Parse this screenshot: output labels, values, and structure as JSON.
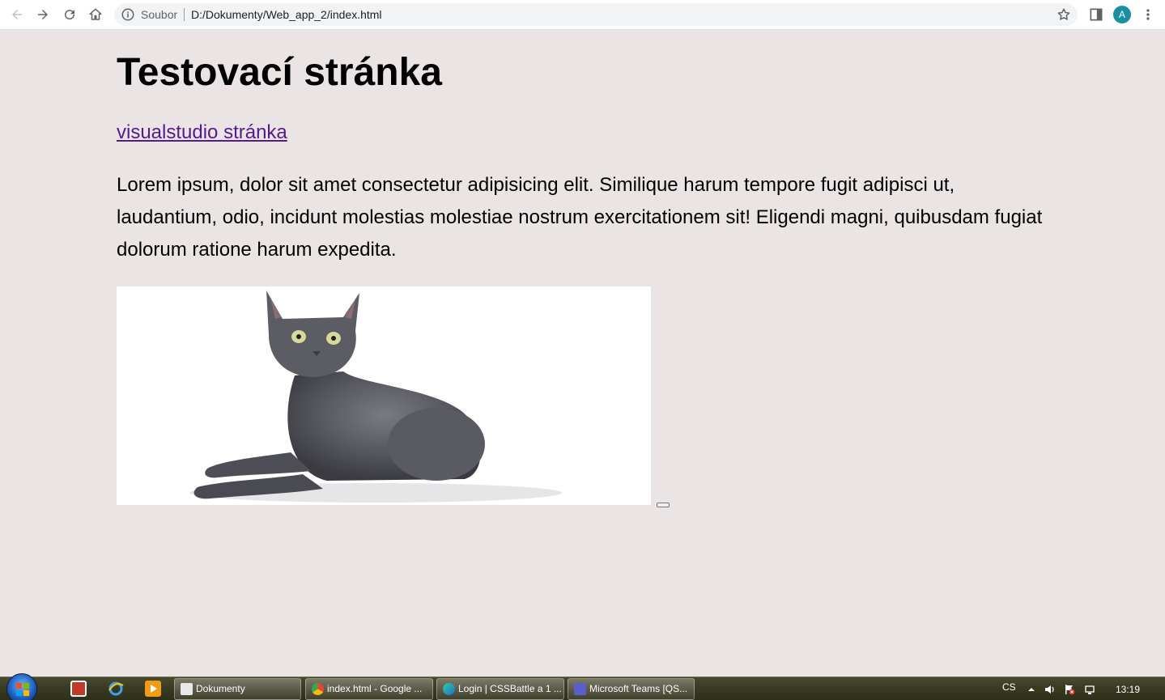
{
  "browser": {
    "scheme_label": "Soubor",
    "url": "D:/Dokumenty/Web_app_2/index.html",
    "profile_initial": "A"
  },
  "page": {
    "title": "Testovací stránka",
    "link_text": "visualstudio stránka",
    "paragraph": "Lorem ipsum, dolor sit amet consectetur adipisicing elit. Similique harum tempore fugit adipisci ut, laudantium, odio, incidunt molestias molestiae nostrum exercitationem sit! Eligendi magni, quibusdam fugiat dolorum ratione harum expedita."
  },
  "taskbar": {
    "windows": [
      {
        "label": "Dokumenty",
        "icon": "folder-icon"
      },
      {
        "label": "index.html - Google ...",
        "icon": "chrome-icon"
      },
      {
        "label": "Login | CSSBattle a 1 ...",
        "icon": "edge-icon"
      },
      {
        "label": "Microsoft Teams [QS...",
        "icon": "teams-icon"
      }
    ],
    "language": "CS",
    "clock": "13:19"
  },
  "colors": {
    "page_background": "#ebe4e4",
    "link": "#551a8b",
    "avatar": "#1a8fa0"
  }
}
